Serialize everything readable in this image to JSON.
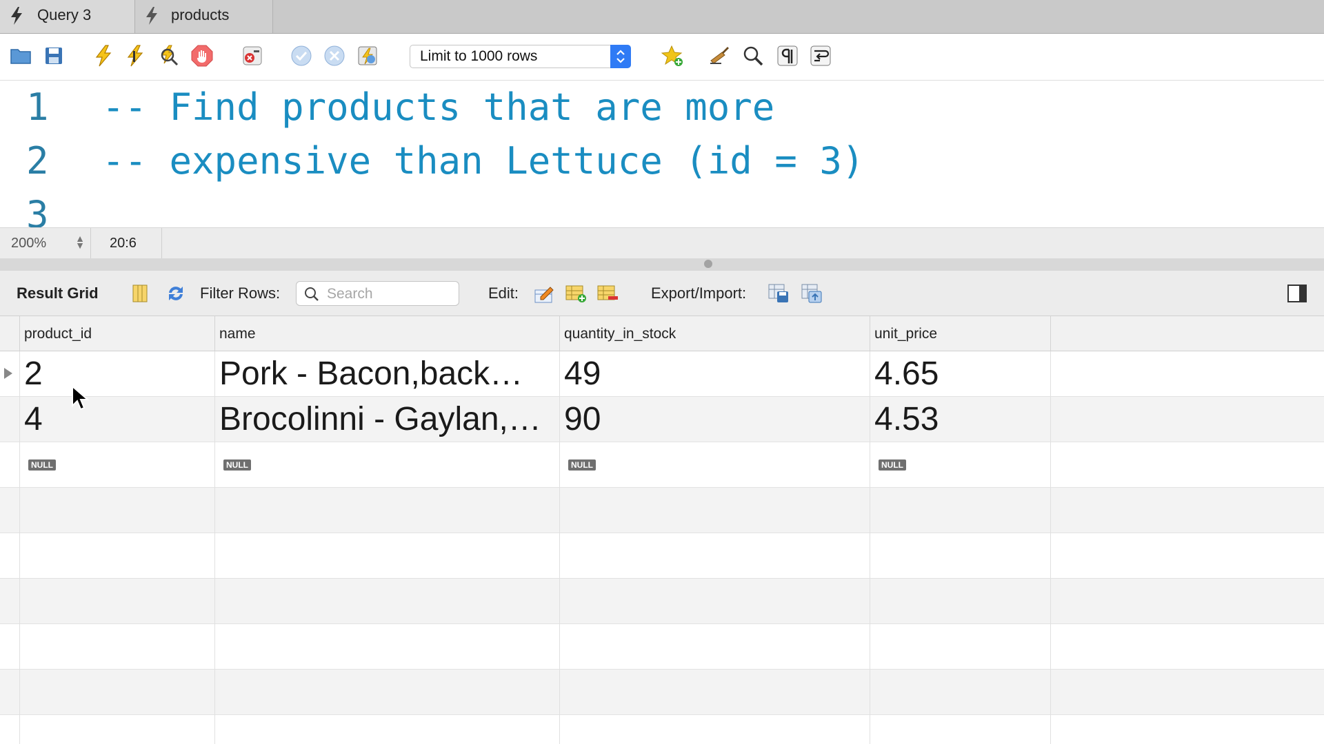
{
  "tabs": [
    {
      "label": "Query 3",
      "active": true
    },
    {
      "label": "products",
      "active": false
    }
  ],
  "toolbar": {
    "icons": [
      "open-folder-icon",
      "save-icon",
      "execute-icon",
      "execute-current-icon",
      "explain-icon",
      "stop-icon",
      "toggle-error-icon",
      "commit-icon",
      "rollback-icon",
      "autocommit-icon",
      "add-snippet-icon",
      "beautify-icon",
      "find-icon",
      "invisibles-icon",
      "word-wrap-icon"
    ],
    "limit_select": "Limit to 1000 rows"
  },
  "editor": {
    "lines": [
      {
        "number": "1",
        "text": "-- Find products that are more"
      },
      {
        "number": "2",
        "text": "-- expensive than Lettuce (id = 3)"
      },
      {
        "number": "3",
        "text": ""
      }
    ]
  },
  "statusbar": {
    "zoom": "200%",
    "cursor_pos": "20:6"
  },
  "result_toolbar": {
    "title": "Result Grid",
    "filter_label": "Filter Rows:",
    "search_placeholder": "Search",
    "edit_label": "Edit:",
    "export_label": "Export/Import:"
  },
  "grid": {
    "columns": [
      "product_id",
      "name",
      "quantity_in_stock",
      "unit_price"
    ],
    "rows": [
      [
        "2",
        "Pork - Bacon,back…",
        "49",
        "4.65"
      ],
      [
        "4",
        "Brocolinni - Gaylan,…",
        "90",
        "4.53"
      ]
    ],
    "null_label": "NULL"
  },
  "colors": {
    "accent": "#2f7bf5",
    "sql_comment": "#1a8dc1",
    "line_number": "#2a7ea5"
  }
}
